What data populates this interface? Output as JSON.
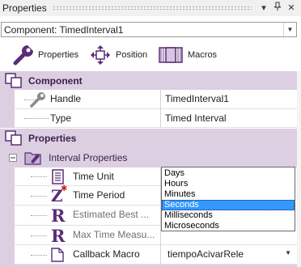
{
  "window": {
    "title": "Properties"
  },
  "component_selector": {
    "value": "Component: TimedInterval1"
  },
  "toolbar": {
    "tabs": [
      {
        "label": "Properties",
        "icon": "wrench-icon"
      },
      {
        "label": "Position",
        "icon": "move-arrows-icon"
      },
      {
        "label": "Macros",
        "icon": "macro-icon"
      }
    ]
  },
  "sections": {
    "component": {
      "title": "Component",
      "rows": [
        {
          "name": "Handle",
          "value": "TimedInterval1"
        },
        {
          "name": "Type",
          "value": "Timed Interval"
        }
      ]
    },
    "properties": {
      "title": "Properties",
      "group": "Interval Properties",
      "rows": [
        {
          "name": "Time Unit",
          "value": ""
        },
        {
          "name": "Time Period",
          "value": ""
        },
        {
          "name": "Estimated Best ...",
          "value": ""
        },
        {
          "name": "Max Time Measu...",
          "value": ""
        },
        {
          "name": "Callback Macro",
          "value": "tiempoAcivarRele"
        }
      ]
    }
  },
  "time_unit_dropdown": {
    "options": [
      "Days",
      "Hours",
      "Minutes",
      "Seconds",
      "Milliseconds",
      "Microseconds"
    ],
    "selected": "Seconds"
  },
  "colors": {
    "section_header": "#dccfe1",
    "selection": "#3399ff",
    "title_text": "#3b1e4c"
  }
}
